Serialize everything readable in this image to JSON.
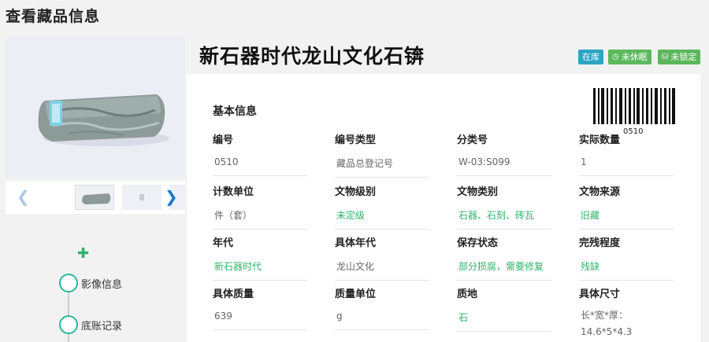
{
  "page": {
    "title": "查看藏品信息"
  },
  "artifact": {
    "name": "新石器时代龙山文化石锛"
  },
  "badges": {
    "stock": "在库",
    "sleep": "未休眠",
    "lock": "未锁定"
  },
  "barcode": {
    "number": "0510"
  },
  "section": {
    "title": "基本信息"
  },
  "fields": [
    {
      "label": "编号",
      "value": "0510"
    },
    {
      "label": "编号类型",
      "value": "藏品总登记号"
    },
    {
      "label": "分类号",
      "value": "W-03:S099"
    },
    {
      "label": "实际数量",
      "value": "1"
    },
    {
      "label": "计数单位",
      "value": "件（套）"
    },
    {
      "label": "文物级别",
      "value": "未定级"
    },
    {
      "label": "文物类别",
      "value": "石器、石刻、砖瓦"
    },
    {
      "label": "文物来源",
      "value": "旧藏"
    },
    {
      "label": "年代",
      "value": "新石器时代"
    },
    {
      "label": "具体年代",
      "value": "龙山文化"
    },
    {
      "label": "保存状态",
      "value": "部分损腐，需要修复"
    },
    {
      "label": "完残程度",
      "value": "残缺"
    },
    {
      "label": "具体质量",
      "value": "639"
    },
    {
      "label": "质量单位",
      "value": "g"
    },
    {
      "label": "质地",
      "value": "石"
    },
    {
      "label": "具体尺寸",
      "value": "长*宽*厚：",
      "value2": "14.6*5*4.3"
    }
  ],
  "timeline": {
    "item1": "影像信息",
    "item2": "底账记录"
  },
  "icons": {
    "prev": "chevron-left-icon",
    "next": "chevron-right-icon",
    "add": "plus-icon",
    "clock": "clock-icon",
    "lock": "lock-icon"
  },
  "colors": {
    "green": "#2fb36b",
    "teal": "#2ca5c4",
    "badge_green": "#5cb85c"
  }
}
